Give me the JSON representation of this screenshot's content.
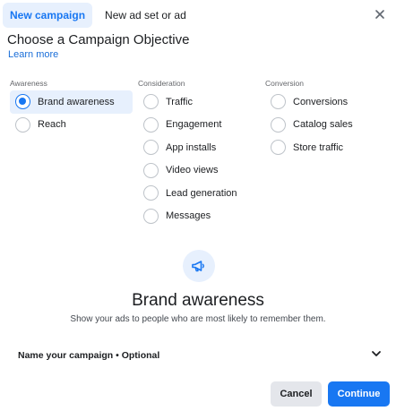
{
  "tabs": [
    {
      "label": "New campaign"
    },
    {
      "label": "New ad set or ad"
    }
  ],
  "header": {
    "title": "Choose a Campaign Objective",
    "learn_more": "Learn more"
  },
  "columns": {
    "awareness": {
      "heading": "Awareness",
      "options": [
        "Brand awareness",
        "Reach"
      ]
    },
    "consideration": {
      "heading": "Consideration",
      "options": [
        "Traffic",
        "Engagement",
        "App installs",
        "Video views",
        "Lead generation",
        "Messages"
      ]
    },
    "conversion": {
      "heading": "Conversion",
      "options": [
        "Conversions",
        "Catalog sales",
        "Store traffic"
      ]
    }
  },
  "selected_objective": "Brand awareness",
  "detail": {
    "title": "Brand awareness",
    "description": "Show your ads to people who are most likely to remember them.",
    "icon": "megaphone-icon"
  },
  "name_campaign": {
    "label": "Name your campaign • Optional"
  },
  "buttons": {
    "cancel": "Cancel",
    "continue": "Continue"
  },
  "colors": {
    "accent": "#1877f2",
    "selected_bg": "#e7f0fd"
  }
}
